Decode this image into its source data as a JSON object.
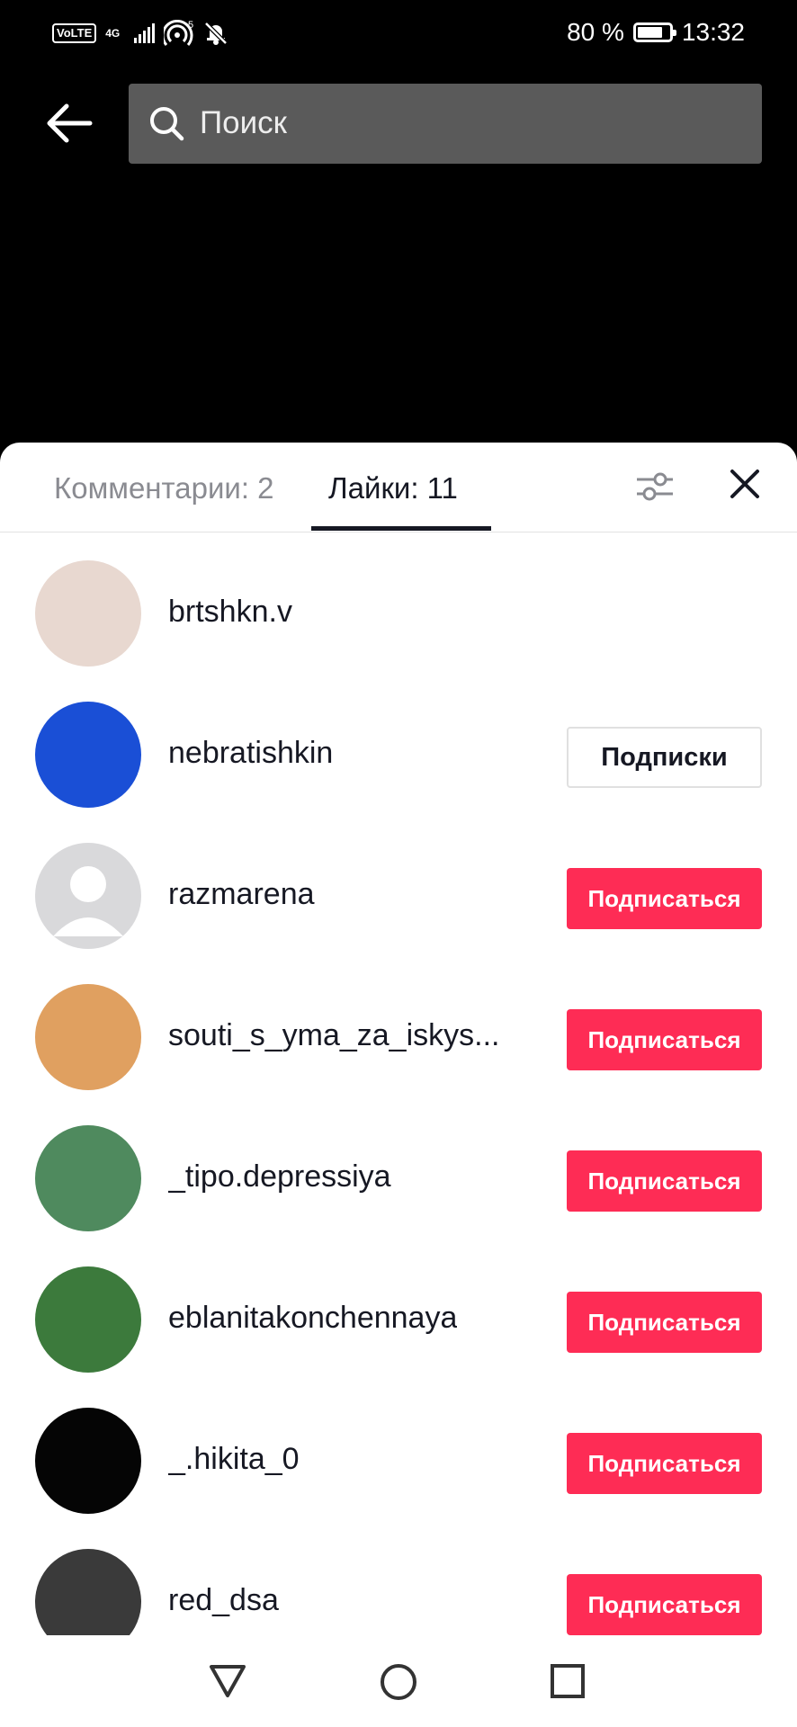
{
  "status_bar": {
    "volte": "VoLTE",
    "network": "4G",
    "battery_text": "80 %",
    "battery_level": 0.8,
    "time": "13:32"
  },
  "search": {
    "placeholder": "Поиск"
  },
  "tabs": {
    "comments": "Комментарии: 2",
    "likes": "Лайки: 11",
    "active": "likes"
  },
  "users": [
    {
      "username": "brtshkn.v",
      "button": "",
      "avatar_color": "#e8d8d0"
    },
    {
      "username": "nebratishkin",
      "button": "Подписки",
      "button_type": "following",
      "avatar_color": "#1a4fd6"
    },
    {
      "username": "razmarena",
      "button": "Подписаться",
      "button_type": "follow",
      "avatar_color": "#d9d9db"
    },
    {
      "username": "souti_s_yma_za_iskys...",
      "button": "Подписаться",
      "button_type": "follow",
      "avatar_color": "#e0a060"
    },
    {
      "username": "_tipo.depressiya",
      "button": "Подписаться",
      "button_type": "follow",
      "avatar_color": "#4f8a5e"
    },
    {
      "username": "eblanitakonchennaya",
      "button": "Подписаться",
      "button_type": "follow",
      "avatar_color": "#3c7a3c"
    },
    {
      "username": "_.hikita_0",
      "button": "Подписаться",
      "button_type": "follow",
      "avatar_color": "#050505"
    },
    {
      "username": "red_dsa",
      "button": "Подписаться",
      "button_type": "follow",
      "avatar_color": "#3a3a3a"
    }
  ],
  "colors": {
    "accent": "#fe2c55",
    "text": "#161823",
    "muted": "#8a8b91"
  }
}
